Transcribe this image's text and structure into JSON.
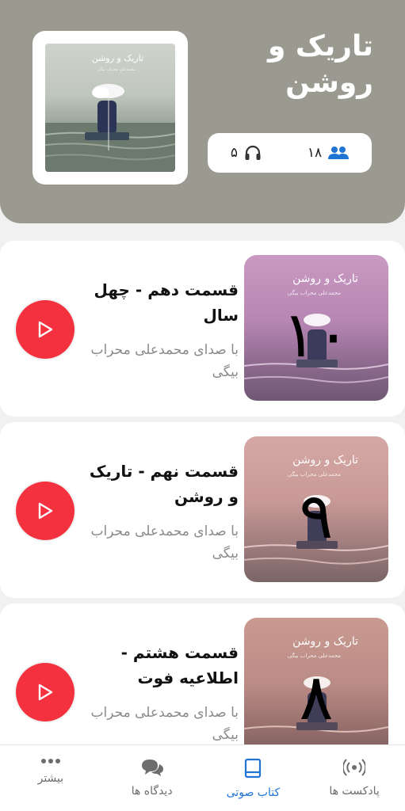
{
  "header": {
    "title": "تاریک و روشن",
    "cover_title": "تاریک و روشن",
    "cover_subtitle": "محمدعلی محراب بیگی",
    "listens": "۵",
    "listens_icon": "headphones-icon",
    "followers": "۱۸",
    "followers_icon": "users-icon"
  },
  "episodes": [
    {
      "title": "قسمت دهم - چهل سال",
      "narrator": "با صدای محمدعلی محراب بیگی",
      "number": "۱۰",
      "art_title": "تاریک و روشن",
      "art_subtitle": "محمدعلی محراب بیگی",
      "play_icon": "play-icon"
    },
    {
      "title": "قسمت نهم - تاریک و روشن",
      "narrator": "با صدای محمدعلی محراب بیگی",
      "number": "۹",
      "art_title": "تاریک و روشن",
      "art_subtitle": "محمدعلی محراب بیگی",
      "play_icon": "play-icon"
    },
    {
      "title": "قسمت هشتم - اطلاعیه فوت",
      "narrator": "با صدای محمدعلی محراب بیگی",
      "number": "۸",
      "art_title": "تاریک و روشن",
      "art_subtitle": "محمدعلی محراب بیگی",
      "play_icon": "play-icon"
    }
  ],
  "tabs": [
    {
      "label": "پادکست ها",
      "icon": "podcast-icon",
      "active": false
    },
    {
      "label": "کتاب صوتی",
      "icon": "book-icon",
      "active": true
    },
    {
      "label": "دیدگاه ها",
      "icon": "comments-icon",
      "active": false
    },
    {
      "label": "بیشتر",
      "icon": "more-icon",
      "active": false
    }
  ],
  "colors": {
    "header_bg": "#9b9a91",
    "play_red": "#f4323f",
    "active_tab": "#1f74d4",
    "followers_icon": "#1f74d4"
  }
}
